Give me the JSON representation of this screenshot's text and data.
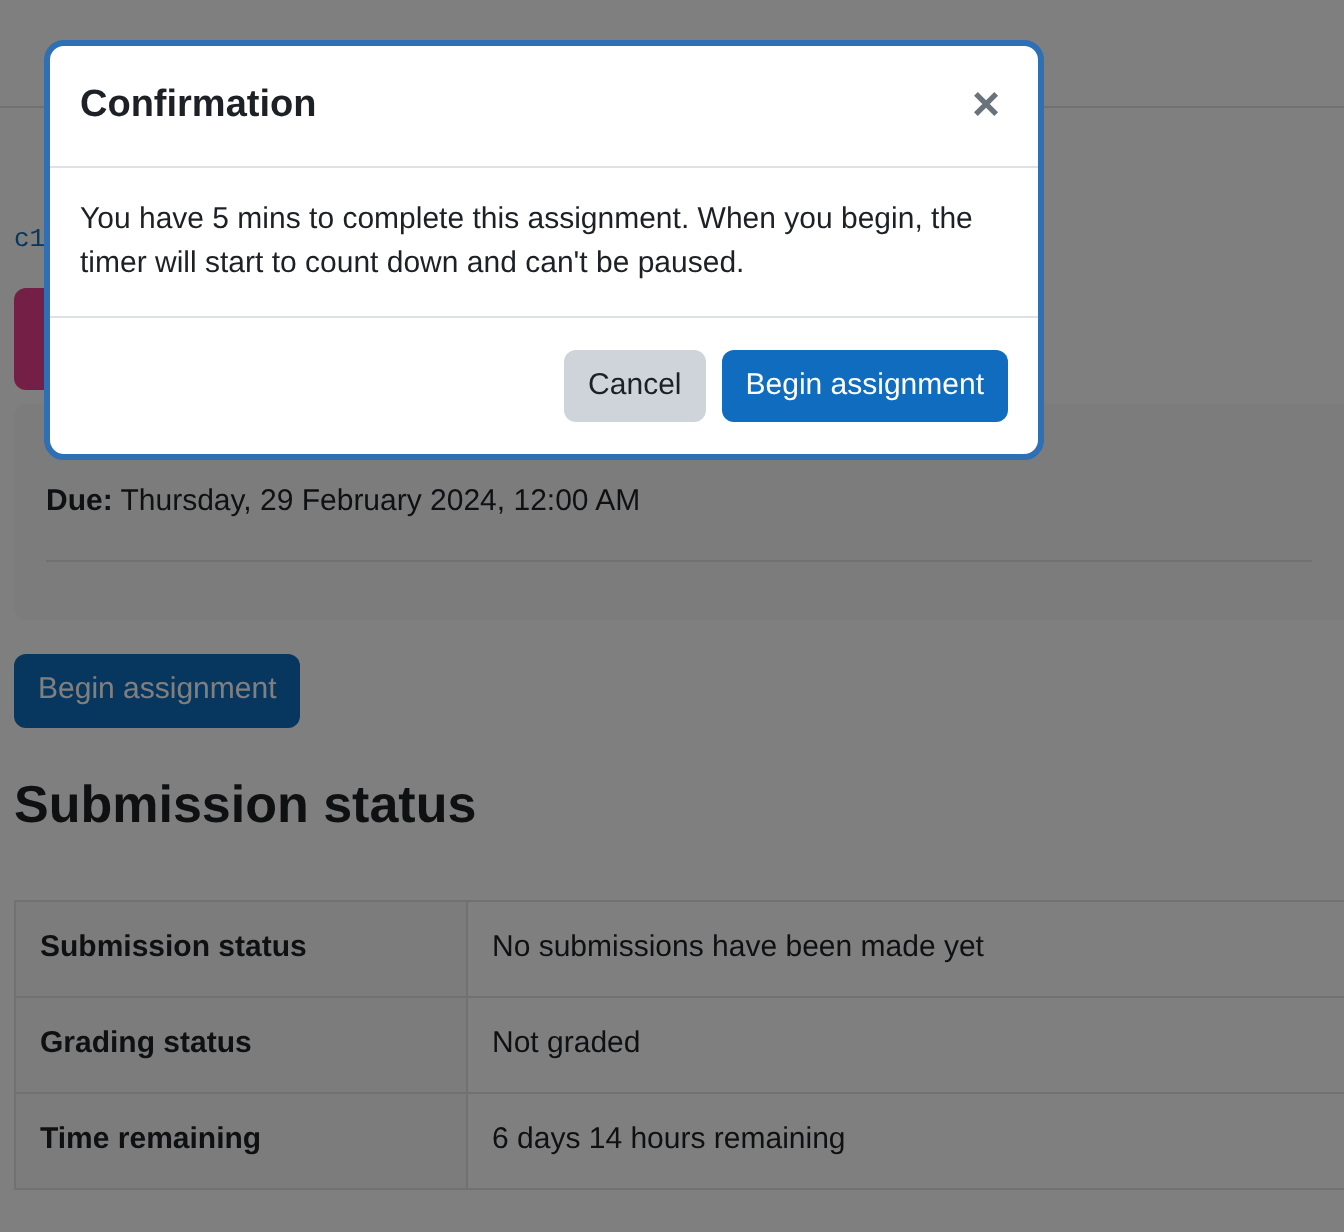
{
  "page": {
    "link_fragment": "c1",
    "dates": [
      {
        "label": "Due:",
        "value": "Thursday, 29 February 2024, 12:00 AM"
      }
    ],
    "begin_button": "Begin assignment",
    "section_title": "Submission status",
    "status_rows": [
      {
        "label": "Submission status",
        "value": "No submissions have been made yet"
      },
      {
        "label": "Grading status",
        "value": "Not graded"
      },
      {
        "label": "Time remaining",
        "value": "6 days 14 hours remaining"
      }
    ]
  },
  "dialog": {
    "title": "Confirmation",
    "close": "×",
    "message": "You have 5 mins to complete this assignment. When you begin, the timer will start to count down and can't be paused.",
    "buttons": [
      {
        "label": "Cancel",
        "kind": "secondary"
      },
      {
        "label": "Begin assignment",
        "kind": "primary"
      }
    ]
  }
}
